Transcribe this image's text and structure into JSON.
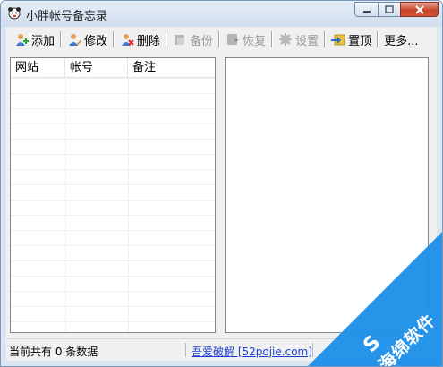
{
  "window": {
    "title": "小胖帐号备忘录"
  },
  "toolbar": {
    "add_label": "添加",
    "edit_label": "修改",
    "delete_label": "删除",
    "backup_label": "备份",
    "restore_label": "恢复",
    "settings_label": "设置",
    "pin_label": "置顶",
    "more_label": "更多..."
  },
  "list": {
    "columns": [
      "网站",
      "帐号",
      "备注"
    ],
    "rows": []
  },
  "status": {
    "count_text": "当前共有 0 条数据",
    "link_text": "吾爱破解 [52pojie.com]"
  },
  "watermark": {
    "text": "海绵软件"
  },
  "colors": {
    "link": "#1a3fd0",
    "watermark": "#1a8ee8",
    "close_button": "#c7462b"
  }
}
